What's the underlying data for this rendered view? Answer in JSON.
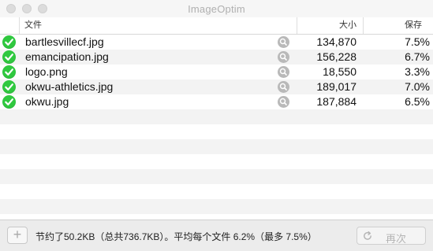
{
  "window": {
    "title": "ImageOptim",
    "traffic_lights": [
      "close-button",
      "minimize-button",
      "zoom-button"
    ]
  },
  "table": {
    "headers": {
      "file": "文件",
      "size": "大小",
      "savings": "保存"
    },
    "rows": [
      {
        "name": "bartlesvillecf.jpg",
        "size": "134,870",
        "savings": "7.5%",
        "status": "done"
      },
      {
        "name": "emancipation.jpg",
        "size": "156,228",
        "savings": "6.7%",
        "status": "done"
      },
      {
        "name": "logo.png",
        "size": "18,550",
        "savings": "3.3%",
        "status": "done"
      },
      {
        "name": "okwu-athletics.jpg",
        "size": "189,017",
        "savings": "7.0%",
        "status": "done"
      },
      {
        "name": "okwu.jpg",
        "size": "187,884",
        "savings": "6.5%",
        "status": "done"
      }
    ]
  },
  "footer": {
    "add_label": "+",
    "status_text": "节约了50.2KB（总共736.7KB）。平均每个文件 6.2%（最多 7.5%）",
    "retry_label": "再次"
  },
  "colors": {
    "check_green": "#2fc83f",
    "row_alt": "#f3f3f3",
    "disabled_text": "#b4b4b4"
  },
  "icons": {
    "status": "checkmark-circle-icon",
    "preview": "magnifier-icon",
    "retry": "refresh-icon"
  }
}
